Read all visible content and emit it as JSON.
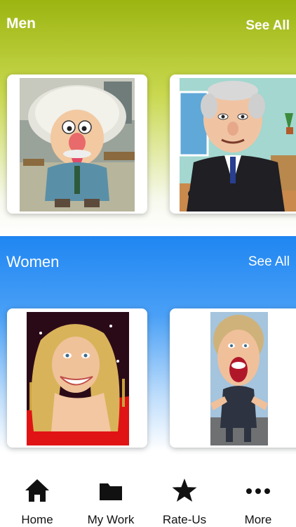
{
  "men": {
    "title": "Men",
    "see_all": "See All"
  },
  "women": {
    "title": "Women",
    "see_all": "See All"
  },
  "tabs": [
    {
      "label": "Home",
      "icon": "home-icon"
    },
    {
      "label": "My Work",
      "icon": "folder-icon"
    },
    {
      "label": "Rate-Us",
      "icon": "star-icon"
    },
    {
      "label": "More",
      "icon": "more-icon"
    }
  ]
}
